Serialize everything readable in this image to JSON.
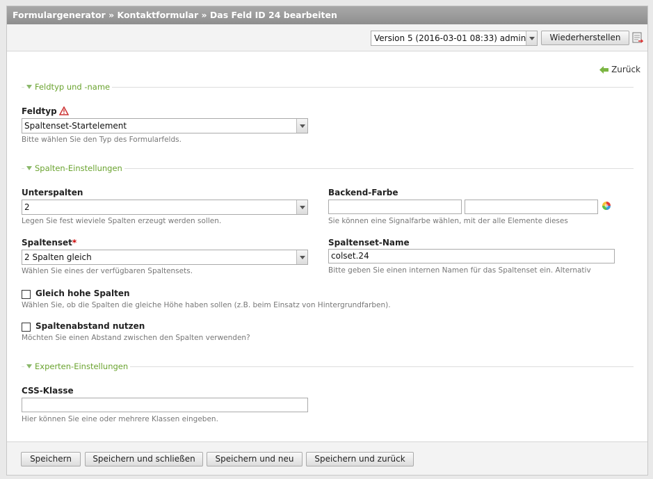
{
  "breadcrumb": "Formulargenerator » Kontaktformular » Das Feld ID 24 bearbeiten",
  "version": {
    "selected": "Version 5 (2016-03-01 08:33) admin",
    "restore_label": "Wiederherstellen",
    "restore_icon": "restore-icon"
  },
  "back_label": "Zurück",
  "sections": {
    "s1": "Feldtyp und -name",
    "s2": "Spalten-Einstellungen",
    "s3": "Experten-Einstellungen"
  },
  "fields": {
    "feldtyp": {
      "label": "Feldtyp",
      "value": "Spaltenset-Startelement",
      "hint": "Bitte wählen Sie den Typ des Formularfelds."
    },
    "unterspalten": {
      "label": "Unterspalten",
      "value": "2",
      "hint": "Legen Sie fest wieviele Spalten erzeugt werden sollen."
    },
    "backend_farbe": {
      "label": "Backend-Farbe",
      "value1": "",
      "value2": "",
      "hint": "Sie können eine Signalfarbe wählen, mit der alle Elemente dieses"
    },
    "spaltenset": {
      "label": "Spaltenset",
      "required": "*",
      "value": "2 Spalten gleich",
      "hint": "Wählen Sie eines der verfügbaren Spaltensets."
    },
    "spaltenset_name": {
      "label": "Spaltenset-Name",
      "value": "colset.24",
      "hint": "Bitte geben Sie einen internen Namen für das Spaltenset ein. Alternativ"
    },
    "gleich_hohe": {
      "label": "Gleich hohe Spalten",
      "checked": false,
      "hint": "Wählen Sie, ob die Spalten die gleiche Höhe haben sollen (z.B. beim Einsatz von Hintergrundfarben)."
    },
    "spaltenabstand": {
      "label": "Spaltenabstand nutzen",
      "checked": false,
      "hint": "Möchten Sie einen Abstand zwischen den Spalten verwenden?"
    },
    "css_klasse": {
      "label": "CSS-Klasse",
      "value": "",
      "hint": "Hier können Sie eine oder mehrere Klassen eingeben."
    }
  },
  "footer": {
    "save": "Speichern",
    "save_close": "Speichern und schließen",
    "save_new": "Speichern und neu",
    "save_back": "Speichern und zurück"
  },
  "colors": {
    "accent": "#6aa32f",
    "titlebar": "#999999"
  }
}
